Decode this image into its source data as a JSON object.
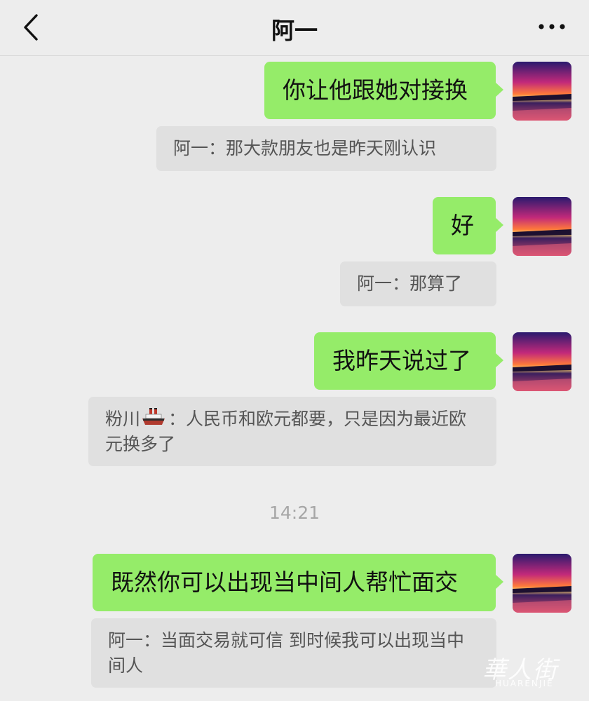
{
  "header": {
    "title": "阿一",
    "back_icon": "chevron-left-icon",
    "more_icon": "ellipsis-icon"
  },
  "colors": {
    "background": "#ededed",
    "sent_bubble": "#95ec69",
    "quote_bubble": "#e0e0e0",
    "time_text": "#a6a6a6"
  },
  "messages": [
    {
      "text": "你让他跟她对接换",
      "quote": "阿一：那大款朋友也是昨天刚认识"
    },
    {
      "text": "好",
      "quote": "阿一：那算了"
    },
    {
      "text": "我昨天说过了",
      "quote_name": "粉川",
      "quote_emoji": "ship-icon",
      "quote": "：人民币和欧元都要，只是因为最近欧元换多了"
    },
    {
      "text": "既然你可以出现当中间人帮忙面交",
      "quote": "阿一：当面交易就可信 到时候我可以出现当中间人"
    }
  ],
  "timestamp": "14:21",
  "watermark": {
    "cn": "華人街",
    "en": "HUARENJIE"
  }
}
